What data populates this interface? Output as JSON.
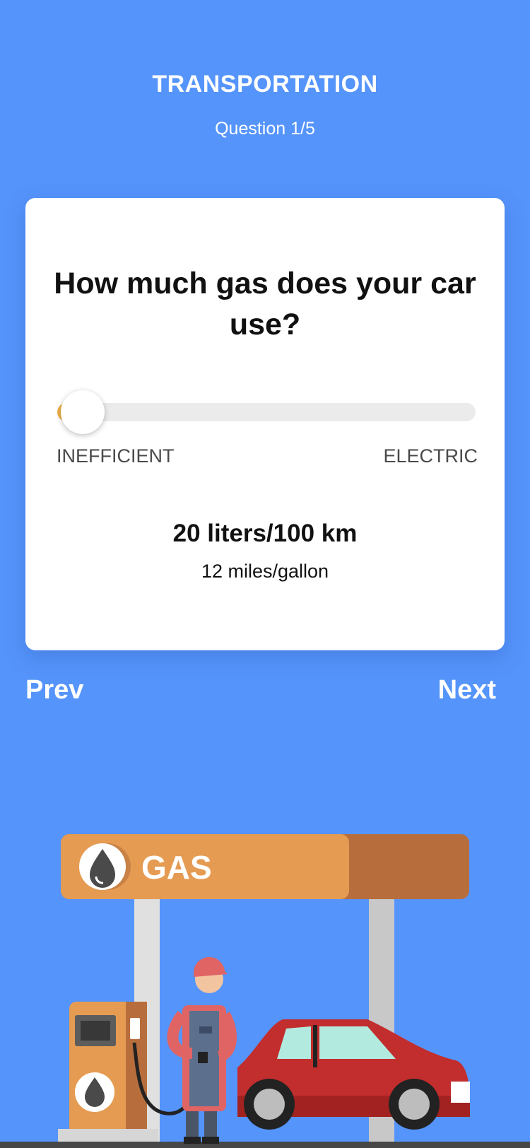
{
  "header": {
    "title": "TRANSPORTATION",
    "progress": "Question 1/5"
  },
  "question": {
    "text": "How much gas does your car use?",
    "slider": {
      "min_label": "INEFFICIENT",
      "max_label": "ELECTRIC",
      "fraction": 0.0
    },
    "value_primary": "20 liters/100 km",
    "value_secondary": "12 miles/gallon"
  },
  "nav": {
    "prev_label": "Prev",
    "next_label": "Next"
  },
  "illustration": {
    "sign_text": "GAS"
  },
  "colors": {
    "background": "#5594fb",
    "slider_fill": "#f0b24a",
    "sign": "#e59b52",
    "car": "#c22d2d"
  }
}
